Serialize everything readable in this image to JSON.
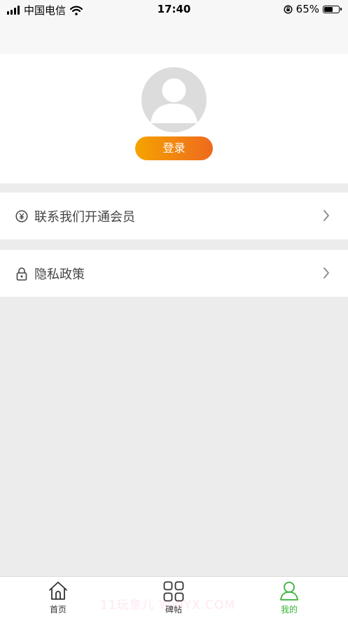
{
  "status_bar": {
    "carrier": "中国电信",
    "time": "17:40",
    "battery": "65%",
    "battery_level": 0.65
  },
  "profile": {
    "login_label": "登录"
  },
  "menu": [
    {
      "label": "联系我们开通会员",
      "icon": "yen-circle-icon"
    },
    {
      "label": "隐私政策",
      "icon": "lock-icon"
    }
  ],
  "tabs": [
    {
      "label": "首页",
      "icon": "home-icon",
      "active": false
    },
    {
      "label": "碑帖",
      "icon": "grid-icon",
      "active": false
    },
    {
      "label": "我的",
      "icon": "user-icon",
      "active": true
    }
  ],
  "colors": {
    "accent_start": "#f5a300",
    "accent_end": "#ee6a1e",
    "active_tab": "#35b335"
  },
  "watermark": "11玩意儿 WWYX.COM"
}
